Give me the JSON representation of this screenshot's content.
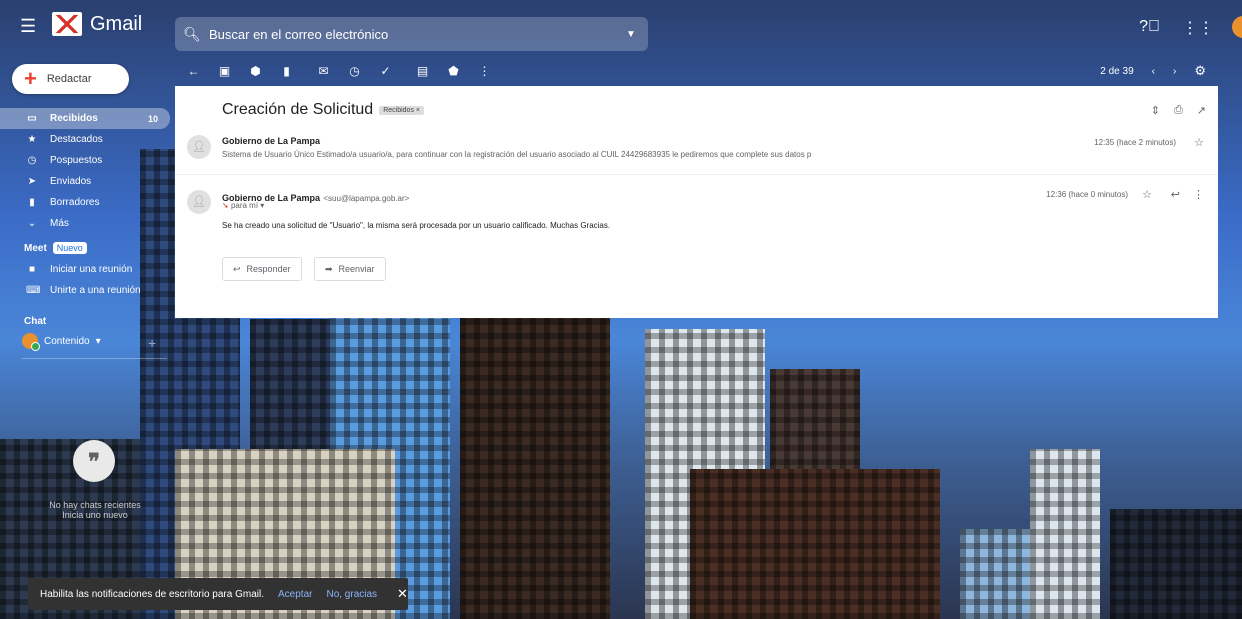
{
  "app": {
    "name": "Gmail"
  },
  "search": {
    "placeholder": "Buscar en el correo electrónico"
  },
  "compose": {
    "label": "Redactar"
  },
  "sidebar": {
    "items": [
      {
        "label": "Recibidos",
        "count": "10",
        "icon": "inbox-icon"
      },
      {
        "label": "Destacados",
        "icon": "star-icon"
      },
      {
        "label": "Pospuestos",
        "icon": "clock-icon"
      },
      {
        "label": "Enviados",
        "icon": "send-icon"
      },
      {
        "label": "Borradores",
        "icon": "draft-icon"
      },
      {
        "label": "Más",
        "icon": "chevron-down-icon"
      }
    ]
  },
  "meet": {
    "title": "Meet",
    "badge": "Nuevo",
    "items": [
      {
        "label": "Iniciar una reunión",
        "icon": "video-icon"
      },
      {
        "label": "Unirte a una reunión",
        "icon": "keyboard-icon"
      }
    ]
  },
  "chat": {
    "title": "Chat",
    "user": "Contenido",
    "empty_line1": "No hay chats recientes",
    "empty_line2": "Inicia uno nuevo"
  },
  "toolbar": {
    "pagination": "2 de 39"
  },
  "email": {
    "subject": "Creación de Solicitud",
    "label": "Recibidos ×",
    "messages": [
      {
        "sender": "Gobierno de La Pampa",
        "snippet": "Sistema de Usuario Único Estimado/a usuario/a, para continuar con la registración del usuario asociado al CUIL 24429683935 le pediremos que complete sus datos p",
        "time": "12:35 (hace 2 minutos)"
      },
      {
        "sender": "Gobierno de La Pampa",
        "address": "<suu@lapampa.gob.ar>",
        "to": "para mí",
        "time": "12:36 (hace 0 minutos)",
        "body": "Se ha creado una solicitud de \"Usuario\", la misma será procesada por un usuario calificado. Muchas Gracias."
      }
    ],
    "reply_label": "Responder",
    "forward_label": "Reenviar"
  },
  "snackbar": {
    "message": "Habilita las notificaciones de escritorio para Gmail.",
    "accept": "Aceptar",
    "decline": "No, gracias",
    "close": "✕"
  }
}
